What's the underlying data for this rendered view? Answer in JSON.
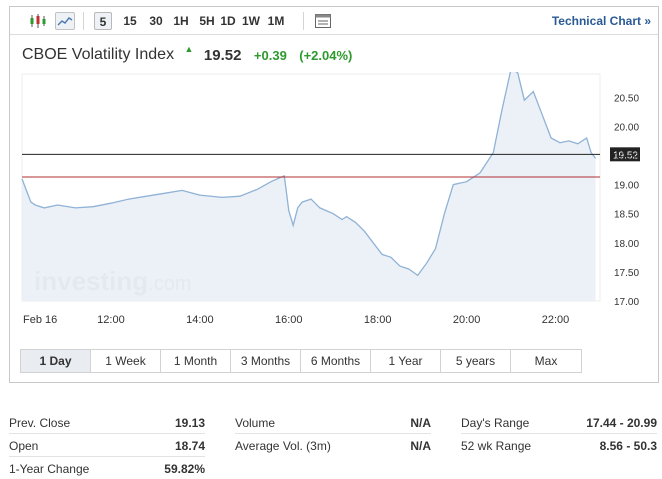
{
  "toolbar": {
    "timeframes": [
      "5",
      "15",
      "30",
      "1H",
      "5H",
      "1D",
      "1W",
      "1M"
    ],
    "active_timeframe": "5",
    "technical_chart_label": "Technical Chart »"
  },
  "instrument": {
    "name": "CBOE Volatility Index",
    "last": "19.52",
    "change": "+0.39",
    "change_pct": "(+2.04%)",
    "up_color": "#2e9a2e"
  },
  "chart_data": {
    "type": "area",
    "title": "",
    "xlabel": "",
    "ylabel": "",
    "x_tick_labels": [
      "Feb 16",
      "12:00",
      "14:00",
      "16:00",
      "18:00",
      "20:00",
      "22:00"
    ],
    "y_tick_labels": [
      "17.00",
      "17.50",
      "18.00",
      "18.50",
      "19.00",
      "19.50",
      "20.00",
      "20.50"
    ],
    "ylim": [
      17.0,
      20.9
    ],
    "x_unit": "hour of day (Feb 16)",
    "xlim": [
      10.0,
      23.0
    ],
    "last_price": 19.52,
    "last_price_label": "19.52",
    "reference_line": {
      "value": 19.13,
      "color": "#b03030"
    },
    "line_color": "#8fb2d6",
    "fill_color": "#e7eef6",
    "watermark": "investing.com",
    "series": [
      {
        "x": [
          10.0,
          10.1,
          10.2,
          10.3,
          10.5,
          10.8,
          11.2,
          11.6,
          12.0,
          12.4,
          12.8,
          13.2,
          13.6,
          14.0,
          14.5,
          14.9,
          15.3,
          15.6,
          15.8,
          15.9,
          16.0,
          16.1,
          16.2,
          16.3,
          16.5,
          16.7,
          17.0,
          17.2,
          17.3,
          17.5,
          17.7,
          17.9,
          18.1,
          18.3,
          18.5,
          18.7,
          18.9,
          19.1,
          19.3,
          19.5,
          19.7,
          20.0,
          20.3,
          20.6,
          20.8,
          21.0,
          21.15,
          21.3,
          21.5,
          21.7,
          21.9,
          22.1,
          22.3,
          22.5,
          22.7,
          22.8,
          22.9
        ],
        "y": [
          19.1,
          18.9,
          18.7,
          18.65,
          18.6,
          18.65,
          18.6,
          18.62,
          18.68,
          18.75,
          18.8,
          18.85,
          18.9,
          18.82,
          18.78,
          18.8,
          18.92,
          19.05,
          19.12,
          19.15,
          18.55,
          18.3,
          18.6,
          18.7,
          18.75,
          18.6,
          18.5,
          18.4,
          18.45,
          18.35,
          18.2,
          18.0,
          17.8,
          17.75,
          17.6,
          17.55,
          17.44,
          17.65,
          17.9,
          18.5,
          19.0,
          19.05,
          19.2,
          19.55,
          20.3,
          20.99,
          20.92,
          20.45,
          20.6,
          20.2,
          19.8,
          19.72,
          19.75,
          19.7,
          19.8,
          19.55,
          19.45
        ]
      }
    ]
  },
  "range_buttons": [
    "1 Day",
    "1 Week",
    "1 Month",
    "3 Months",
    "6 Months",
    "1 Year",
    "5 years",
    "Max"
  ],
  "active_range": "1 Day",
  "stats": {
    "col1": [
      {
        "label": "Prev. Close",
        "value": "19.13"
      },
      {
        "label": "Open",
        "value": "18.74"
      },
      {
        "label": "1-Year Change",
        "value": "59.82%"
      }
    ],
    "col2": [
      {
        "label": "Volume",
        "value": "N/A"
      },
      {
        "label": "Average Vol. (3m)",
        "value": "N/A"
      }
    ],
    "col3": [
      {
        "label": "Day's Range",
        "value": "17.44 - 20.99"
      },
      {
        "label": "52 wk Range",
        "value": "8.56 - 50.3"
      }
    ]
  }
}
